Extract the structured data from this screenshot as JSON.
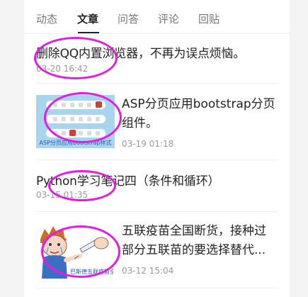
{
  "tabs": [
    {
      "label": "动态",
      "active": false
    },
    {
      "label": "文章",
      "active": true
    },
    {
      "label": "问答",
      "active": false
    },
    {
      "label": "评论",
      "active": false
    },
    {
      "label": "回贴",
      "active": false
    }
  ],
  "articles": [
    {
      "title": "删除QQ内置浏览器，不再为误点烦恼。",
      "date": "03-20 16:42",
      "thumbnail": null
    },
    {
      "title": "ASP分页应用bootstrap分页组件。",
      "date": "03-19 01:18",
      "thumbnail": {
        "name": "asp-pagination-thumbnail",
        "caption": "ASP分页应用bootstrap样式"
      }
    },
    {
      "title": "Python学习笔记四（条件和循环）",
      "date": "03-15 01:35",
      "thumbnail": null
    },
    {
      "title": "五联疫苗全国断货，接种过部分五联苗的要选择替代...",
      "date": "03-12 15:04",
      "thumbnail": {
        "name": "vaccine-cartoon-thumbnail",
        "caption": "巴斯德五联疫苗全国断货"
      }
    }
  ],
  "annotation_color": "#e21ce2"
}
